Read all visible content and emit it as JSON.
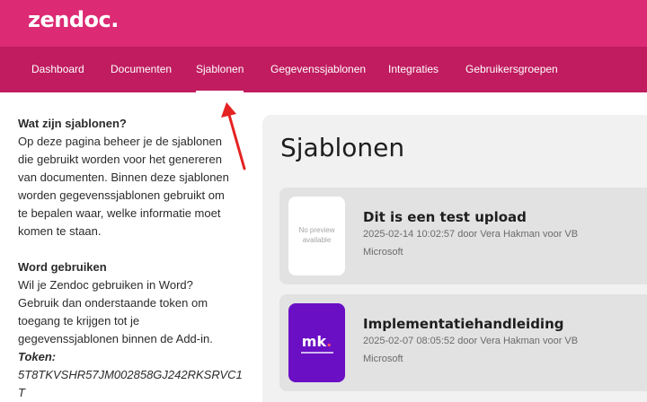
{
  "header": {
    "logo": "zendoc."
  },
  "nav": {
    "items": [
      {
        "label": "Dashboard"
      },
      {
        "label": "Documenten"
      },
      {
        "label": "Sjablonen"
      },
      {
        "label": "Gegevenssjablonen"
      },
      {
        "label": "Integraties"
      },
      {
        "label": "Gebruikersgroepen"
      }
    ],
    "active": "Sjablonen"
  },
  "sidebar": {
    "section1_heading": "Wat zijn sjablonen?",
    "section1_lines": [
      "Op deze pagina beheer je de sjablonen",
      "die gebruikt worden voor het genereren",
      "van documenten. Binnen deze sjablonen",
      "worden gegevenssjablonen gebruikt om",
      "te bepalen waar, welke informatie moet",
      "komen te staan."
    ],
    "section2_heading": "Word gebruiken",
    "section2_lines": [
      "Wil je Zendoc gebruiken in Word?",
      "Gebruik dan onderstaande token om",
      "toegang te krijgen tot je",
      "gegevenssjablonen binnen de Add-in."
    ],
    "token_label": "Token:",
    "token_value": "5T8TKVSHR57JM002858GJ242RKSRVC1T"
  },
  "main": {
    "title": "Sjablonen",
    "templates": [
      {
        "title": "Dit is een test upload",
        "meta": "2025-02-14 10:02:57 door Vera Hakman voor VB",
        "type": "Microsoft",
        "preview_text": [
          "No preview",
          "available"
        ]
      },
      {
        "title": "Implementatiehandleiding",
        "meta": "2025-02-07 08:05:52 door Vera Hakman voor VB",
        "type": "Microsoft",
        "thumb_text": "mk",
        "thumb_color": "#6a0fc4"
      }
    ]
  },
  "colors": {
    "topbar": "#dc2a74",
    "nav": "#c01c5f",
    "arrow": "#e52222"
  }
}
